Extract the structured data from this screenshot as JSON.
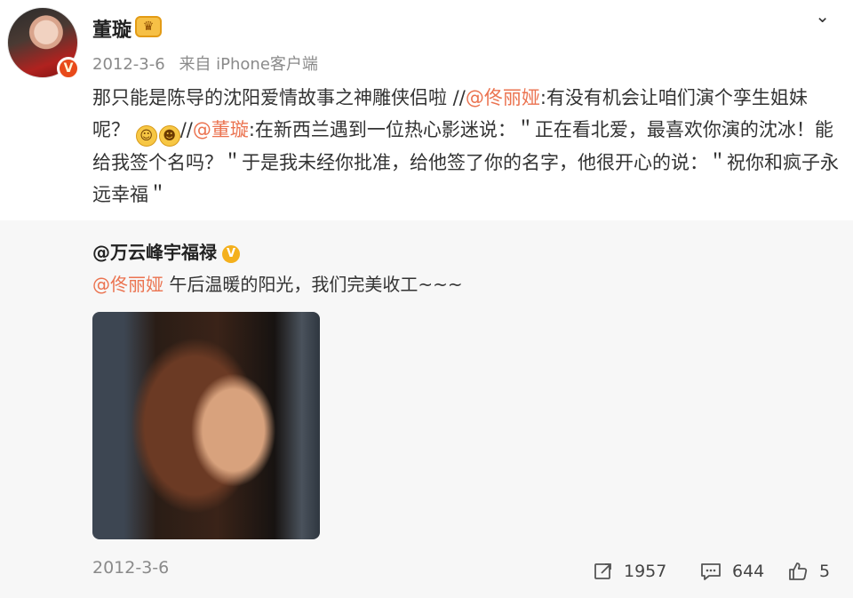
{
  "post": {
    "username": "董璇",
    "date": "2012-3-6",
    "source": "来自 iPhone客户端",
    "content_parts": [
      "那只能是陈导的沈阳爱情故事之神雕侠侣啦 //",
      "@佟丽娅",
      ":有没有机会让咱们演个孪生姐妹呢？ ",
      "//",
      "@董璇",
      ":在新西兰遇到一位热心影迷说：＂正在看北爱，最喜欢你演的沈冰！能给我签个名吗？＂于是我未经你批准，给他签了你的名字，他很开心的说：＂祝你和疯子永远幸福＂"
    ],
    "emojis": [
      "smile-emoji",
      "blush-emoji"
    ]
  },
  "repost": {
    "username": "@万云峰宇福禄",
    "mention": "@佟丽娅",
    "text": " 午后温暖的阳光，我们完美收工~~~"
  },
  "footer": {
    "date": "2012-3-6",
    "repost_count": "1957",
    "comment_count": "644",
    "like_count": "5"
  },
  "colors": {
    "mention": "#eb7350",
    "repost_bg": "#f7f7f7",
    "meta": "#8a8a8a"
  }
}
